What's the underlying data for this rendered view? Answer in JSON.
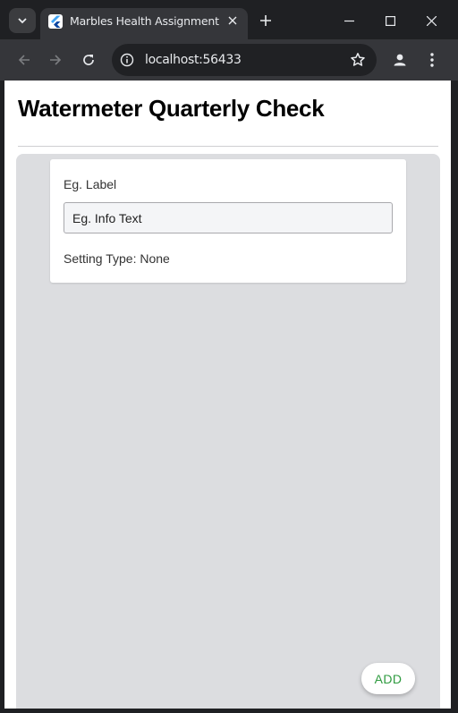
{
  "browser": {
    "tab_title": "Marbles Health Assignment",
    "url": "localhost:56433",
    "icons": {
      "tab_search": "chevron-down-icon",
      "favicon": "flutter-icon",
      "tab_close": "close-icon",
      "new_tab": "plus-icon",
      "minimize": "minimize-icon",
      "maximize": "maximize-icon",
      "close_window": "close-icon",
      "back": "arrow-left-icon",
      "forward": "arrow-right-icon",
      "reload": "reload-icon",
      "site_info": "info-icon",
      "bookmark": "star-icon",
      "profile": "person-icon",
      "menu": "kebab-icon"
    }
  },
  "app": {
    "title": "Watermeter Quarterly Check",
    "card": {
      "label": "Eg. Label",
      "input_value": "Eg. Info Text",
      "setting_type": "Setting Type: None"
    },
    "add_label": "ADD"
  },
  "colors": {
    "chrome_dark": "#1f2023",
    "toolbar": "#35363a",
    "panel_bg": "#dcdde0",
    "add_text": "#2e9b3f"
  }
}
